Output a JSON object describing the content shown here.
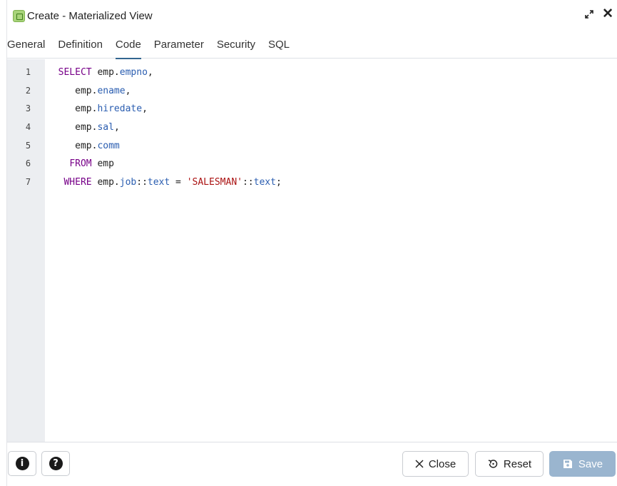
{
  "dialog": {
    "title": "Create - Materialized View"
  },
  "tabs": [
    {
      "label": "General"
    },
    {
      "label": "Definition"
    },
    {
      "label": "Code"
    },
    {
      "label": "Parameter"
    },
    {
      "label": "Security"
    },
    {
      "label": "SQL"
    }
  ],
  "active_tab": "Code",
  "editor": {
    "line_numbers": [
      "1",
      "2",
      "3",
      "4",
      "5",
      "6",
      "7"
    ],
    "code": {
      "l1_kw": "SELECT",
      "l1_obj": "emp.",
      "l1_col": "empno",
      "l1_tail": ",",
      "l2_obj": "emp.",
      "l2_col": "ename",
      "l2_tail": ",",
      "l3_obj": "emp.",
      "l3_col": "hiredate",
      "l3_tail": ",",
      "l4_obj": "emp.",
      "l4_col": "sal",
      "l4_tail": ",",
      "l5_obj": "emp.",
      "l5_col": "comm",
      "l6_kw": "FROM",
      "l6_obj": "emp",
      "l7_kw": "WHERE",
      "l7_obj": "emp.",
      "l7_col": "job",
      "l7_cast1": "::",
      "l7_type1": "text",
      "l7_eq": " = ",
      "l7_str": "'SALESMAN'",
      "l7_cast2": "::",
      "l7_type2": "text",
      "l7_end": ";"
    }
  },
  "footer": {
    "info_icon": "info-icon",
    "help_icon": "help-icon",
    "close_label": "Close",
    "reset_label": "Reset",
    "save_label": "Save"
  },
  "colors": {
    "accent": "#326690",
    "keyword": "#770088",
    "property": "#2a5db0",
    "string": "#aa1111",
    "save_button": "#9ab5cf"
  }
}
